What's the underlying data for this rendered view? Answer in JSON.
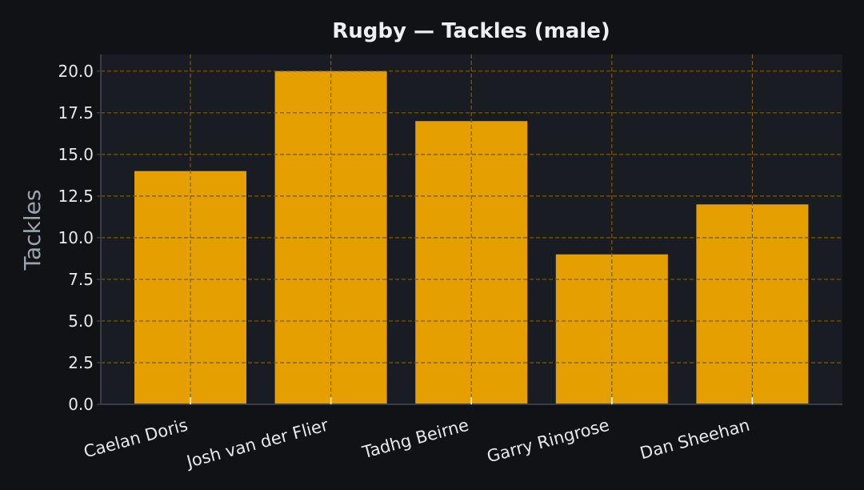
{
  "chart_data": {
    "type": "bar",
    "title": "Rugby — Tackles (male)",
    "xlabel": "",
    "ylabel": "Tackles",
    "categories": [
      "Caelan Doris",
      "Josh van der Flier",
      "Tadhg Beirne",
      "Garry Ringrose",
      "Dan Sheehan"
    ],
    "values": [
      14,
      20,
      17,
      9,
      12
    ],
    "ylim": [
      0,
      21
    ],
    "yticks": [
      "0.0",
      "2.5",
      "5.0",
      "7.5",
      "10.0",
      "12.5",
      "15.0",
      "17.5",
      "20.0"
    ],
    "grid": true,
    "legend": "none"
  },
  "colors": {
    "page_background": "#111216",
    "plot_background": "#1a1c23",
    "bar": "#e69f00",
    "gridline": "#7a5a10",
    "axis": "#3a3d45"
  }
}
